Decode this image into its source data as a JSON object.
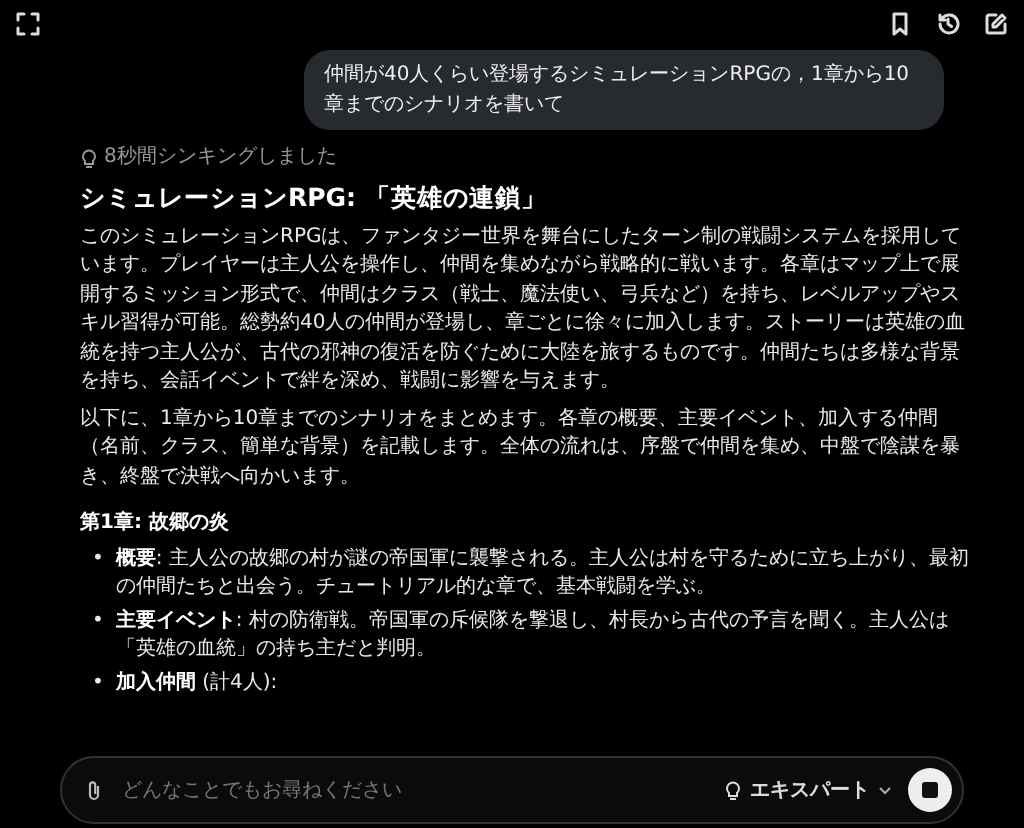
{
  "user_message": "仲間が40人くらい登場するシミュレーションRPGの，1章から10章までのシナリオを書いて",
  "thinking": "8秒間シンキングしました",
  "answer": {
    "title": "シミュレーションRPG: 「英雄の連鎖」",
    "paragraphs": [
      "このシミュレーションRPGは、ファンタジー世界を舞台にしたターン制の戦闘システムを採用しています。プレイヤーは主人公を操作し、仲間を集めながら戦略的に戦います。各章はマップ上で展開するミッション形式で、仲間はクラス（戦士、魔法使い、弓兵など）を持ち、レベルアップやスキル習得が可能。総勢約40人の仲間が登場し、章ごとに徐々に加入します。ストーリーは英雄の血統を持つ主人公が、古代の邪神の復活を防ぐために大陸を旅するものです。仲間たちは多様な背景を持ち、会話イベントで絆を深め、戦闘に影響を与えます。",
      "以下に、1章から10章までのシナリオをまとめます。各章の概要、主要イベント、加入する仲間（名前、クラス、簡単な背景）を記載します。全体の流れは、序盤で仲間を集め、中盤で陰謀を暴き、終盤で決戦へ向かいます。"
    ],
    "sections": [
      {
        "heading": "第1章: 故郷の炎",
        "bullets": [
          {
            "marker": "•",
            "text": "**概要**: 主人公の故郷の村が謎の帝国軍に襲撃される。主人公は村を守るために立ち上がり、最初の仲間たちと出会う。チュートリアル的な章で、基本戦闘を学ぶ。"
          },
          {
            "marker": "•",
            "text": "**主要イベント**: 村の防衛戦。帝国軍の斥候隊を撃退し、村長から古代の予言を聞く。主人公は「英雄の血統」の持ち主だと判明。"
          },
          {
            "marker": "•",
            "text": "**加入仲間** (計4人):"
          }
        ]
      }
    ]
  },
  "input": {
    "placeholder": "どんなことでもお尋ねください",
    "mode": "エキスパート"
  }
}
